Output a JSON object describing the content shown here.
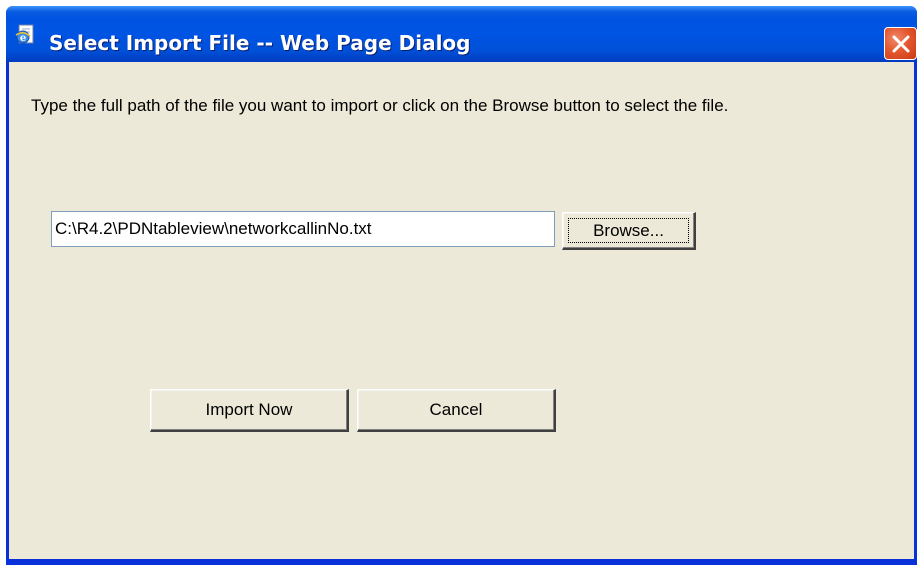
{
  "window": {
    "title": "Select Import File -- Web Page Dialog",
    "title_icon": "ie-page-icon",
    "close_icon": "close-icon"
  },
  "dialog": {
    "instructions": "Type the full path of the file you want to import or click on the Browse button to select the file.",
    "file_path": "C:\\R4.2\\PDNtableview\\networkcallinNo.txt",
    "browse_label": "Browse...",
    "import_label": "Import Now",
    "cancel_label": "Cancel"
  },
  "colors": {
    "titlebar": "#0054e3",
    "client_background": "#ece9d8",
    "close_button": "#e4572f"
  }
}
